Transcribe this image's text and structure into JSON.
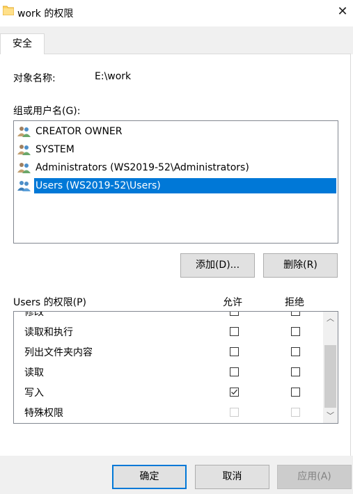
{
  "window": {
    "title": "work 的权限",
    "close_glyph": "✕"
  },
  "tabs": [
    {
      "label": "安全"
    }
  ],
  "object": {
    "label": "对象名称:",
    "value": "E:\\work"
  },
  "groups": {
    "label": "组或用户名(G):",
    "items": [
      {
        "label": "CREATOR OWNER",
        "icon": "users-icon",
        "selected": false
      },
      {
        "label": "SYSTEM",
        "icon": "users-icon",
        "selected": false
      },
      {
        "label": "Administrators (WS2019-52\\Administrators)",
        "icon": "users-icon",
        "selected": false
      },
      {
        "label": "Users (WS2019-52\\Users)",
        "icon": "users-icon",
        "selected": true
      }
    ],
    "add_button": "添加(D)...",
    "remove_button": "删除(R)"
  },
  "permissions": {
    "label": "Users 的权限(P)",
    "allow_header": "允许",
    "deny_header": "拒绝",
    "rows": [
      {
        "name": "修改",
        "allow": false,
        "deny": false,
        "disabled": false
      },
      {
        "name": "读取和执行",
        "allow": false,
        "deny": false,
        "disabled": false
      },
      {
        "name": "列出文件夹内容",
        "allow": false,
        "deny": false,
        "disabled": false
      },
      {
        "name": "读取",
        "allow": false,
        "deny": false,
        "disabled": false
      },
      {
        "name": "写入",
        "allow": true,
        "deny": false,
        "disabled": false
      },
      {
        "name": "特殊权限",
        "allow": false,
        "deny": false,
        "disabled": true
      }
    ],
    "scroll_up_glyph": "︿",
    "scroll_down_glyph": "﹀"
  },
  "footer": {
    "ok": "确定",
    "cancel": "取消",
    "apply": "应用(A)"
  },
  "colors": {
    "selection": "#0078d7",
    "border": "#828790",
    "face": "#f0f0f0"
  }
}
